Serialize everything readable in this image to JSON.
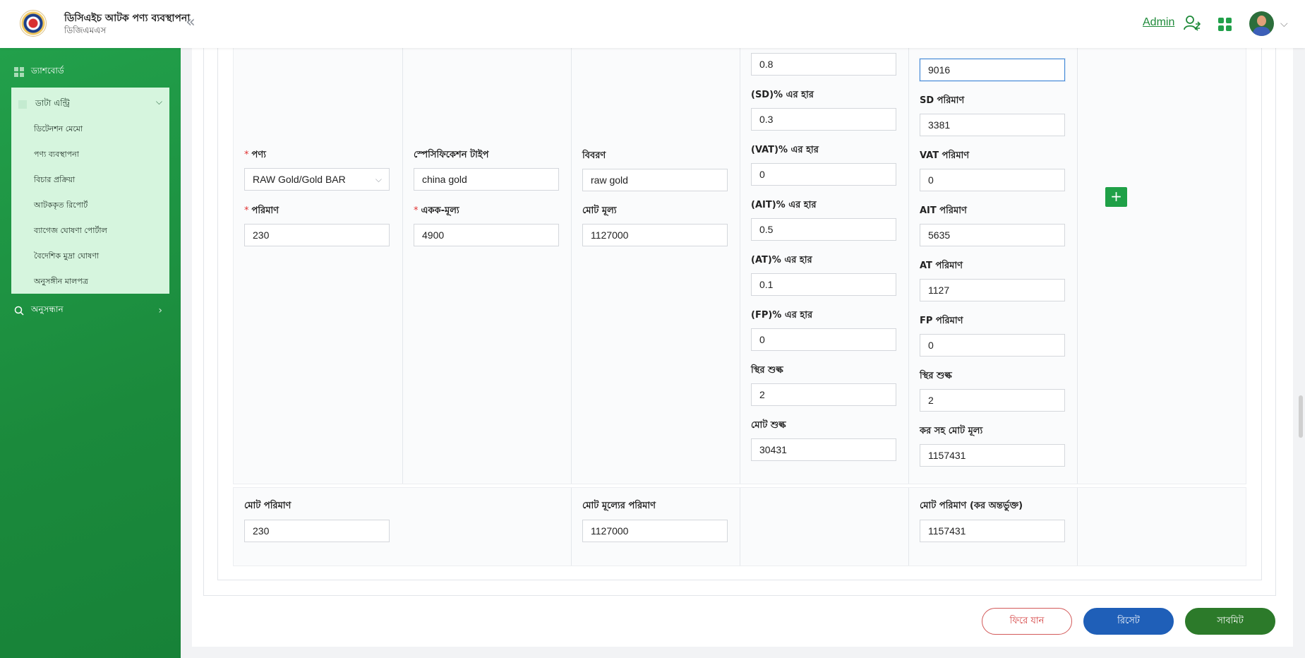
{
  "header": {
    "title": "ডিসিএইচ আটক পণ্য ব্যবস্থাপনা",
    "subtitle": "ডিজিএমএস",
    "admin_label": "Admin",
    "collapse_glyph": "«",
    "avatar_chevron": "⌵"
  },
  "sidebar": {
    "dashboard": "ড্যাশবোর্ড",
    "data_entry": "ডাটা এন্ট্রি",
    "sub_items": [
      "ডিটেনশন মেমো",
      "পণ্য ব্যবস্থাপনা",
      "বিচার প্রক্রিয়া",
      "আটককৃত রিপোর্ট",
      "ব্যাগেজ ঘোষণা পোর্টাল",
      "বৈদেশিক মুদ্রা ঘোষণা",
      "অনুসঙ্গীন মালপত্র"
    ],
    "search": "অনুসন্ধান",
    "search_chevron": "›"
  },
  "form": {
    "product_label": "পণ্য",
    "product_value": "RAW Gold/Gold BAR",
    "quantity_label": "পরিমাণ",
    "quantity_value": "230",
    "spec_type_label": "স্পেসিফিকেশন টাইপ",
    "spec_type_value": "china gold",
    "unit_price_label": "একক-মূল্য",
    "unit_price_value": "4900",
    "description_label": "বিবরণ",
    "description_value": "raw gold",
    "total_value_label": "মোট মূল্য",
    "total_value_value": "1127000",
    "cd_rate_value": "0.8",
    "sd_rate_label": "(SD)% এর হার",
    "sd_rate_value": "0.3",
    "vat_rate_label": "(VAT)% এর হার",
    "vat_rate_value": "0",
    "ait_rate_label": "(AIT)% এর হার",
    "ait_rate_value": "0.5",
    "at_rate_label": "(AT)% এর হার",
    "at_rate_value": "0.1",
    "fp_rate_label": "(FP)% এর হার",
    "fp_rate_value": "0",
    "fixed_duty_label": "স্থির শুল্ক",
    "fixed_duty_value": "2",
    "total_duty_label": "মোট শুল্ক",
    "total_duty_value": "30431",
    "cd_amount_value": "9016",
    "sd_amount_label": "SD পরিমাণ",
    "sd_amount_value": "3381",
    "vat_amount_label": "VAT পরিমাণ",
    "vat_amount_value": "0",
    "ait_amount_label": "AIT পরিমাণ",
    "ait_amount_value": "5635",
    "at_amount_label": "AT পরিমাণ",
    "at_amount_value": "1127",
    "fp_amount_label": "FP পরিমাণ",
    "fp_amount_value": "0",
    "fixed_duty2_label": "স্থির শুল্ক",
    "fixed_duty2_value": "2",
    "total_with_tax_label": "কর সহ মোট মূল্য",
    "total_with_tax_value": "1157431",
    "add_glyph": "+"
  },
  "totals": {
    "total_quantity_label": "মোট পরিমাণ",
    "total_quantity_value": "230",
    "total_price_label": "মোট মূল্যের পরিমাণ",
    "total_price_value": "1127000",
    "total_incl_tax_label": "মোট পরিমাণ (কর অন্তর্ভুক্ত)",
    "total_incl_tax_value": "1157431"
  },
  "actions": {
    "back": "ফিরে যান",
    "reset": "রিসেট",
    "submit": "সাবমিট"
  },
  "colors": {
    "brand_green": "#1fa047",
    "reset_blue": "#1f5fb8",
    "submit_green": "#2c7a2a",
    "back_red": "#d33b3b"
  }
}
